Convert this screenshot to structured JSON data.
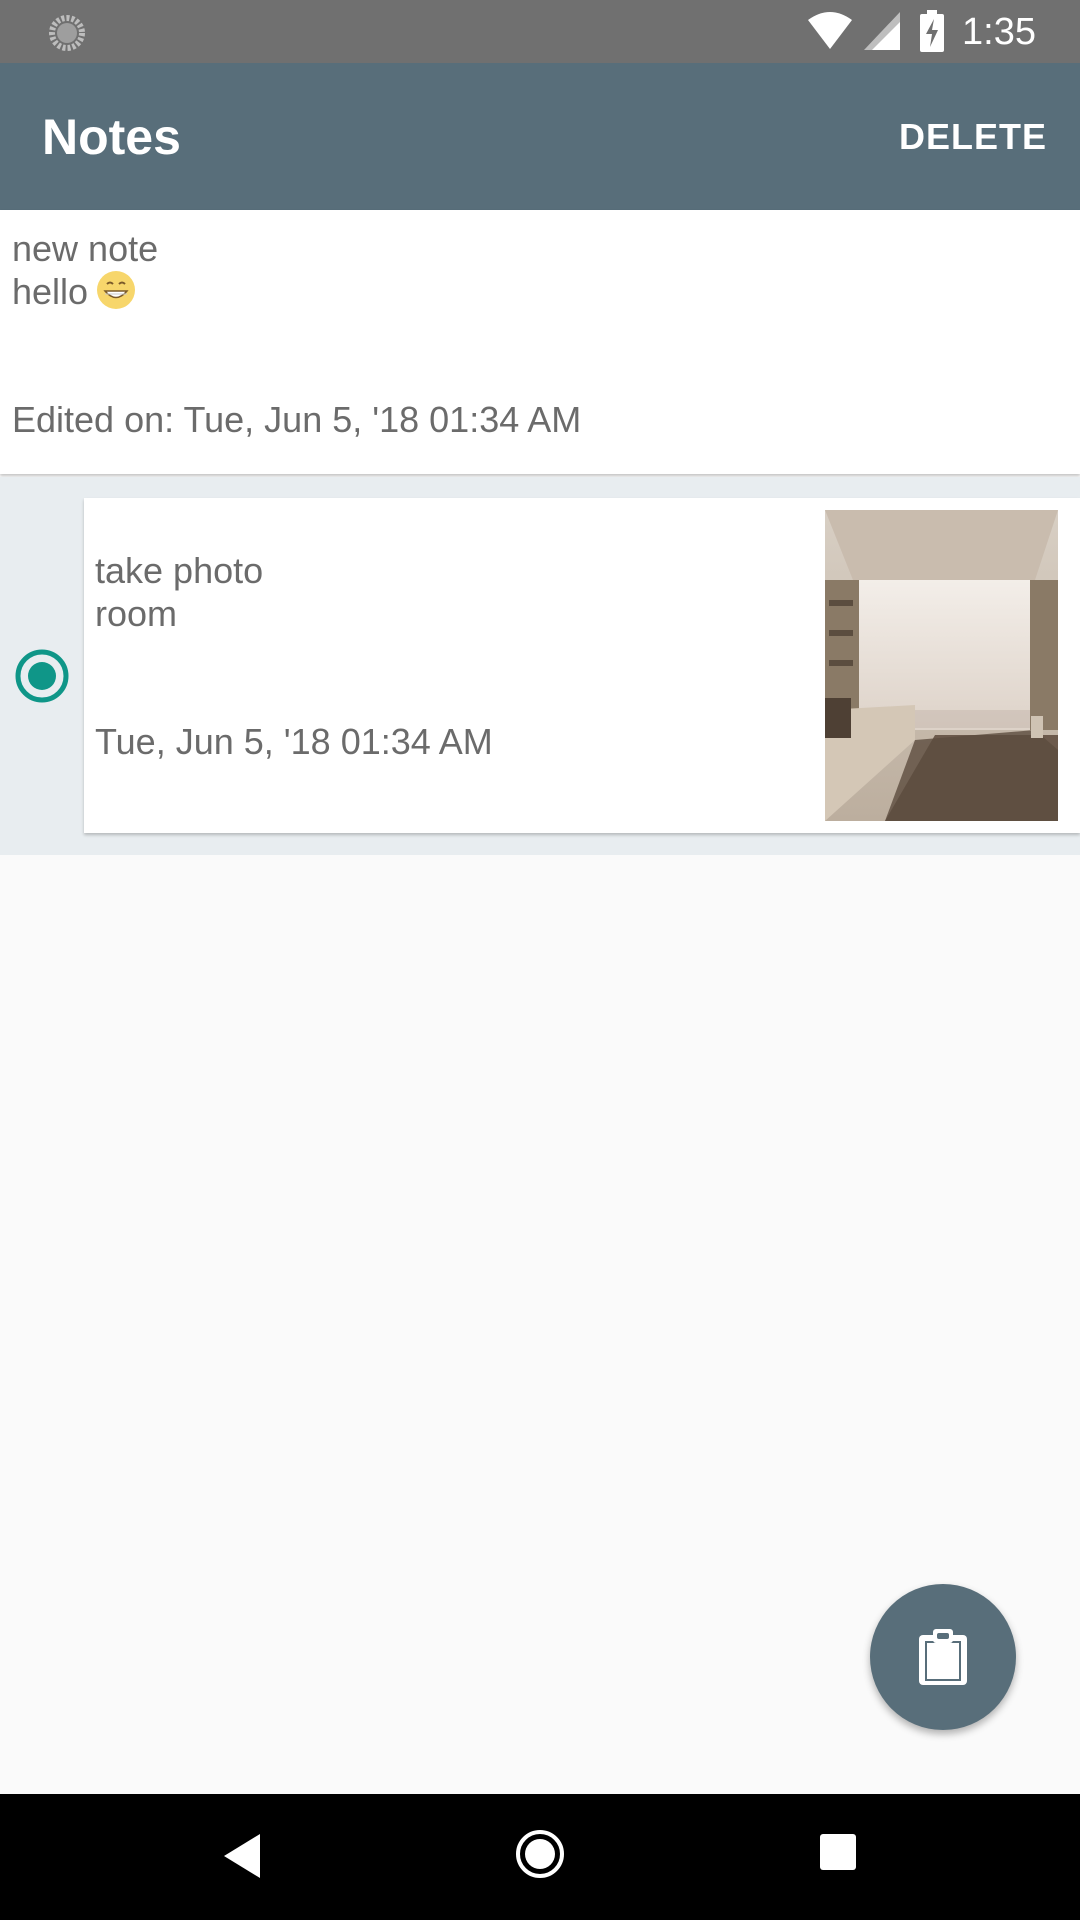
{
  "status_bar": {
    "time": "1:35",
    "icons": [
      "spinner-icon",
      "wifi-icon",
      "cell-signal-icon",
      "battery-charging-icon"
    ]
  },
  "app_bar": {
    "title": "Notes",
    "delete_label": "DELETE"
  },
  "notes": [
    {
      "title": "new note",
      "body": "hello",
      "body_emoji": "grinning-face-emoji",
      "date": "Edited on: Tue, Jun 5, '18 01:34 AM",
      "selected": false
    },
    {
      "title": "take photo",
      "body": "room",
      "date": "Tue, Jun 5, '18 01:34 AM",
      "selected": true,
      "has_image": true
    }
  ],
  "fab": {
    "icon": "clipboard-icon"
  },
  "nav_bar": {
    "icons": [
      "back-icon",
      "home-icon",
      "recents-icon"
    ]
  },
  "colors": {
    "app_bar": "#586e7a",
    "status_bar": "#707070",
    "accent": "#0f9688",
    "selected_row": "#e8edf0"
  }
}
